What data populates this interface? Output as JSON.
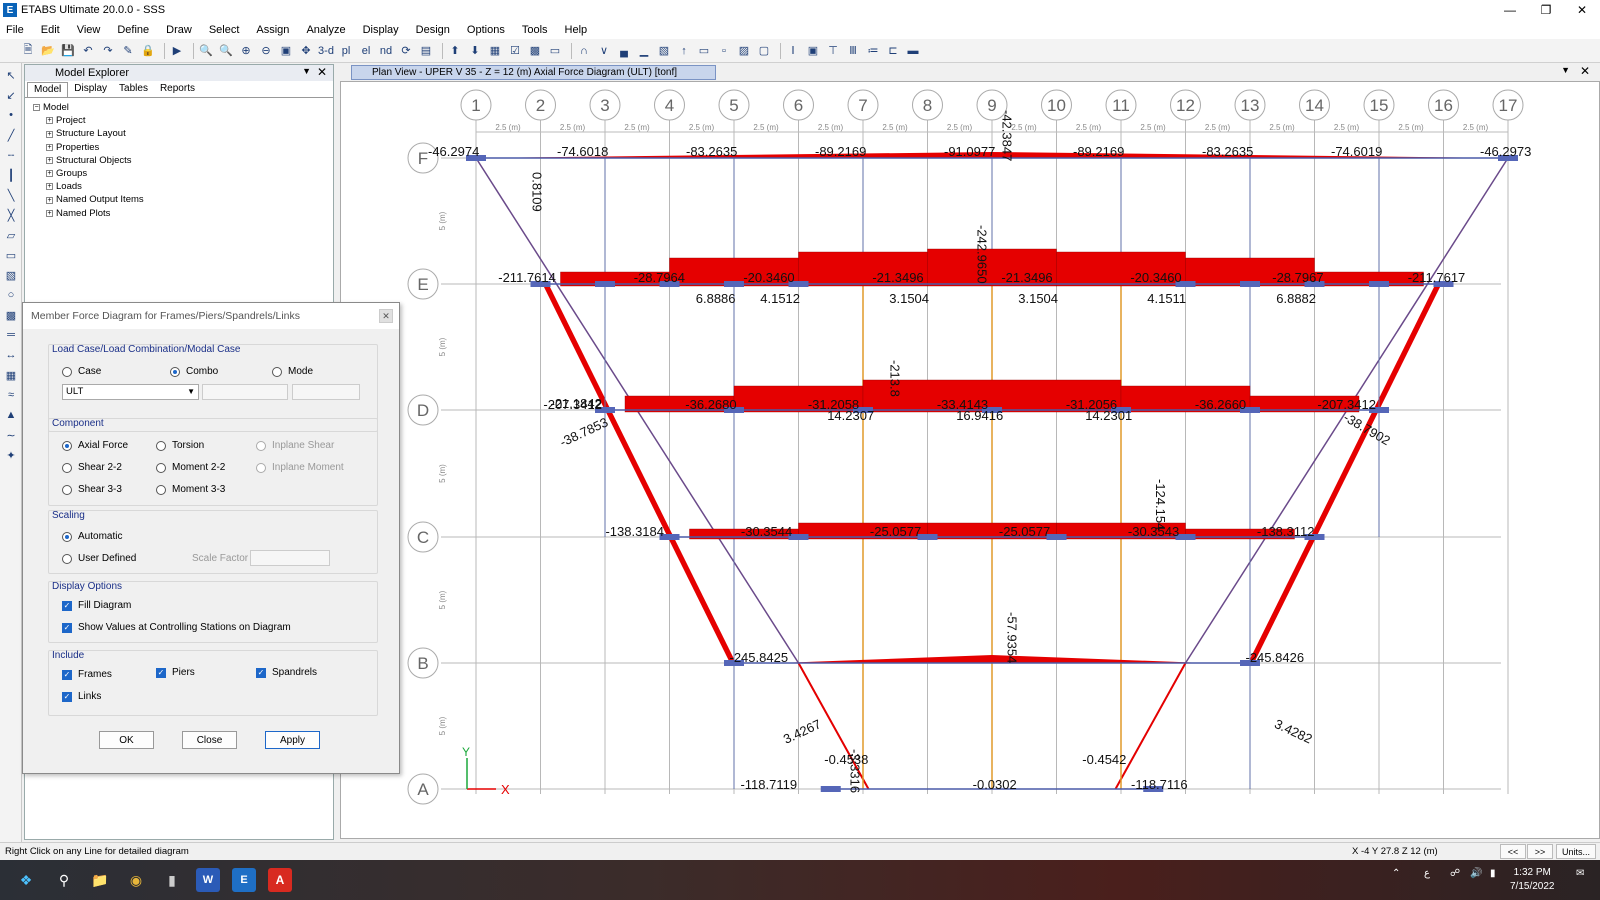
{
  "window": {
    "title": "ETABS Ultimate 20.0.0 - SSS",
    "app_letter": "E"
  },
  "menu": [
    "File",
    "Edit",
    "View",
    "Define",
    "Draw",
    "Select",
    "Assign",
    "Analyze",
    "Display",
    "Design",
    "Options",
    "Tools",
    "Help"
  ],
  "toolbar": {
    "view3d": "3-d",
    "plan": "pl",
    "elev": "el",
    "nd": "nd"
  },
  "explorer": {
    "title": "Model Explorer",
    "tabs": [
      "Model",
      "Display",
      "Tables",
      "Reports"
    ],
    "root": "Model",
    "items": [
      "Project",
      "Structure Layout",
      "Properties",
      "Structural Objects",
      "Groups",
      "Loads",
      "Named Output Items",
      "Named Plots"
    ]
  },
  "dialog": {
    "title": "Member Force Diagram for Frames/Piers/Spandrels/Links",
    "load_group": "Load Case/Load Combination/Modal Case",
    "case": "Case",
    "combo": "Combo",
    "mode": "Mode",
    "combo_value": "ULT",
    "component_group": "Component",
    "axial": "Axial Force",
    "torsion": "Torsion",
    "inplane_shear": "Inplane Shear",
    "shear22": "Shear 2-2",
    "moment22": "Moment 2-2",
    "inplane_moment": "Inplane Moment",
    "shear33": "Shear 3-3",
    "moment33": "Moment 3-3",
    "scaling_group": "Scaling",
    "automatic": "Automatic",
    "user_defined": "User Defined",
    "scale_factor": "Scale Factor",
    "display_group": "Display Options",
    "fill": "Fill Diagram",
    "show_values": "Show Values at Controlling Stations on Diagram",
    "include_group": "Include",
    "frames": "Frames",
    "piers": "Piers",
    "spandrels": "Spandrels",
    "links": "Links",
    "ok": "OK",
    "close": "Close",
    "apply": "Apply"
  },
  "view": {
    "tab_title": "Plan View - UPER V 35 - Z = 12 (m)   Axial Force Diagram   (ULT)  [tonf]"
  },
  "plan": {
    "grid_numbers": [
      "1",
      "2",
      "3",
      "4",
      "5",
      "6",
      "7",
      "8",
      "9",
      "10",
      "11",
      "12",
      "13",
      "14",
      "15",
      "16",
      "17"
    ],
    "grid_letters": [
      "F",
      "E",
      "D",
      "C",
      "B",
      "A"
    ],
    "spacing_x": "2.5 (m)",
    "spacing_y": "5 (m)",
    "axis_x": "X",
    "axis_y": "Y",
    "labels_F": [
      "-46.2974",
      "-74.6018",
      "-83.2635",
      "-89.2169",
      "-91.0977",
      "-89.2169",
      "-83.2635",
      "-74.6019",
      "-46.2973"
    ],
    "labels_E": [
      "-211.7614",
      "-28.7964",
      "-20.3460",
      "-21.3496",
      "-21.3496",
      "-20.3460",
      "-28.7967",
      "-211.7617"
    ],
    "labels_E_shear": [
      "6.8886",
      "4.1512",
      "3.1504",
      "3.1504",
      "4.1511",
      "6.8882"
    ],
    "labels_D": [
      "-207.3412",
      "-36.2680",
      "-31.2058",
      "-33.4143",
      "-31.2056",
      "-36.2660",
      "-207.3412"
    ],
    "labels_D_shear": [
      "14.2307",
      "16.9416",
      "14.2301"
    ],
    "labels_C": [
      "-138.3184",
      "-30.3544",
      "-25.0577",
      "-25.0577",
      "-30.3543",
      "-138.3112"
    ],
    "labels_B": [
      "-245.8425",
      "-245.8426"
    ],
    "labels_A": [
      "-118.7119",
      "-0.4538",
      "-0.0302",
      "-0.4542",
      "-118.7116"
    ],
    "vertical_labels": [
      "0.8109",
      "-42.3847",
      "-242.9650",
      "-213.8",
      "-124.154",
      "-57.9354",
      "-3.3316"
    ],
    "diagonal_labels": [
      "-38.7853",
      "-38.7902",
      "3.4267",
      "3.4282",
      "-21.1842"
    ]
  },
  "status": {
    "hint": "Right Click on any Line for detailed diagram",
    "coords": "X -4  Y 27.8  Z 12 (m)",
    "prev": "<<",
    "next": ">>",
    "units": "Units..."
  },
  "taskbar": {
    "time": "1:32 PM",
    "date": "7/15/2022"
  },
  "colors": {
    "diagram": "#e50000",
    "beam": "#4a5aa8",
    "column_bar": "#5566b8",
    "grid": "#b8b8b8"
  }
}
